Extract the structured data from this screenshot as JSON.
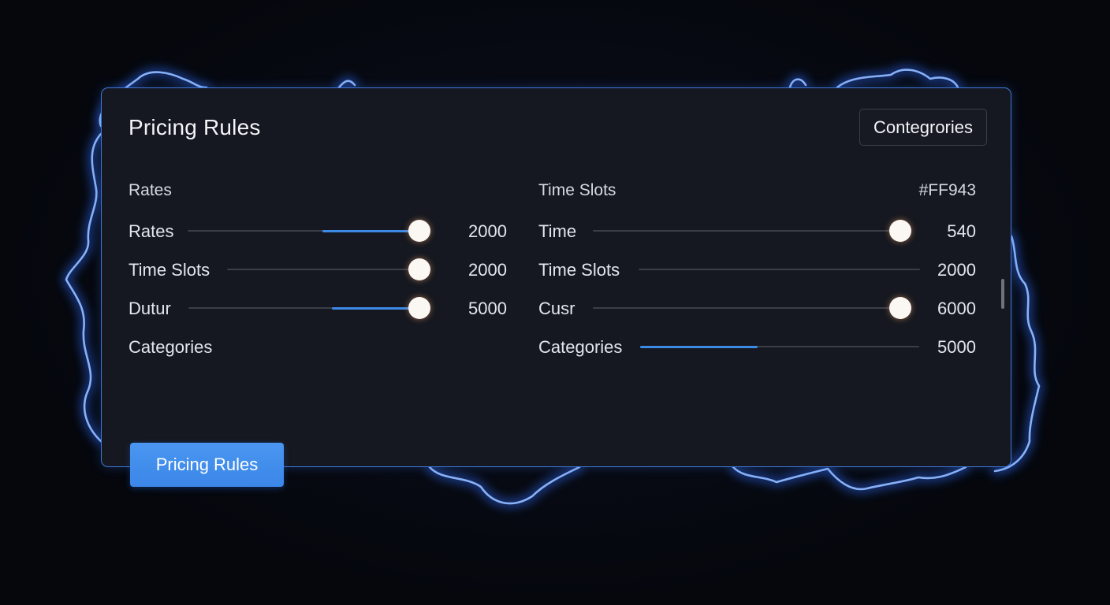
{
  "panel": {
    "title": "Pricing Rules",
    "categories_button": "Contegrories",
    "left_header": "Rates",
    "right_header": "Time Slots",
    "color_code": "#FF943",
    "left_rows": [
      {
        "label": "Rates",
        "value": "2000",
        "fill_start": 0.58,
        "fill_end": 1.0,
        "thumb": 1.0
      },
      {
        "label": "Time Slots",
        "value": "2000",
        "thumb": 1.0
      },
      {
        "label": "Dutur",
        "value": "5000",
        "fill_start": 0.62,
        "fill_end": 1.0,
        "thumb": 1.0
      },
      {
        "label": "Categories"
      }
    ],
    "right_rows": [
      {
        "label": "Time",
        "value": "540",
        "thumb": 1.0
      },
      {
        "label": "Time Slots",
        "value": "2000"
      },
      {
        "label": "Cusr",
        "value": "6000",
        "thumb": 1.0
      },
      {
        "label": "Categories",
        "value": "5000",
        "fill_start": 0.0,
        "fill_end": 0.42
      }
    ],
    "save_button": "Pricing Rules"
  },
  "colors": {
    "accent": "#3d8ae6",
    "glow": "#4b8dff",
    "panel_bg": "#151820",
    "thumb": "#fbf7f3"
  }
}
